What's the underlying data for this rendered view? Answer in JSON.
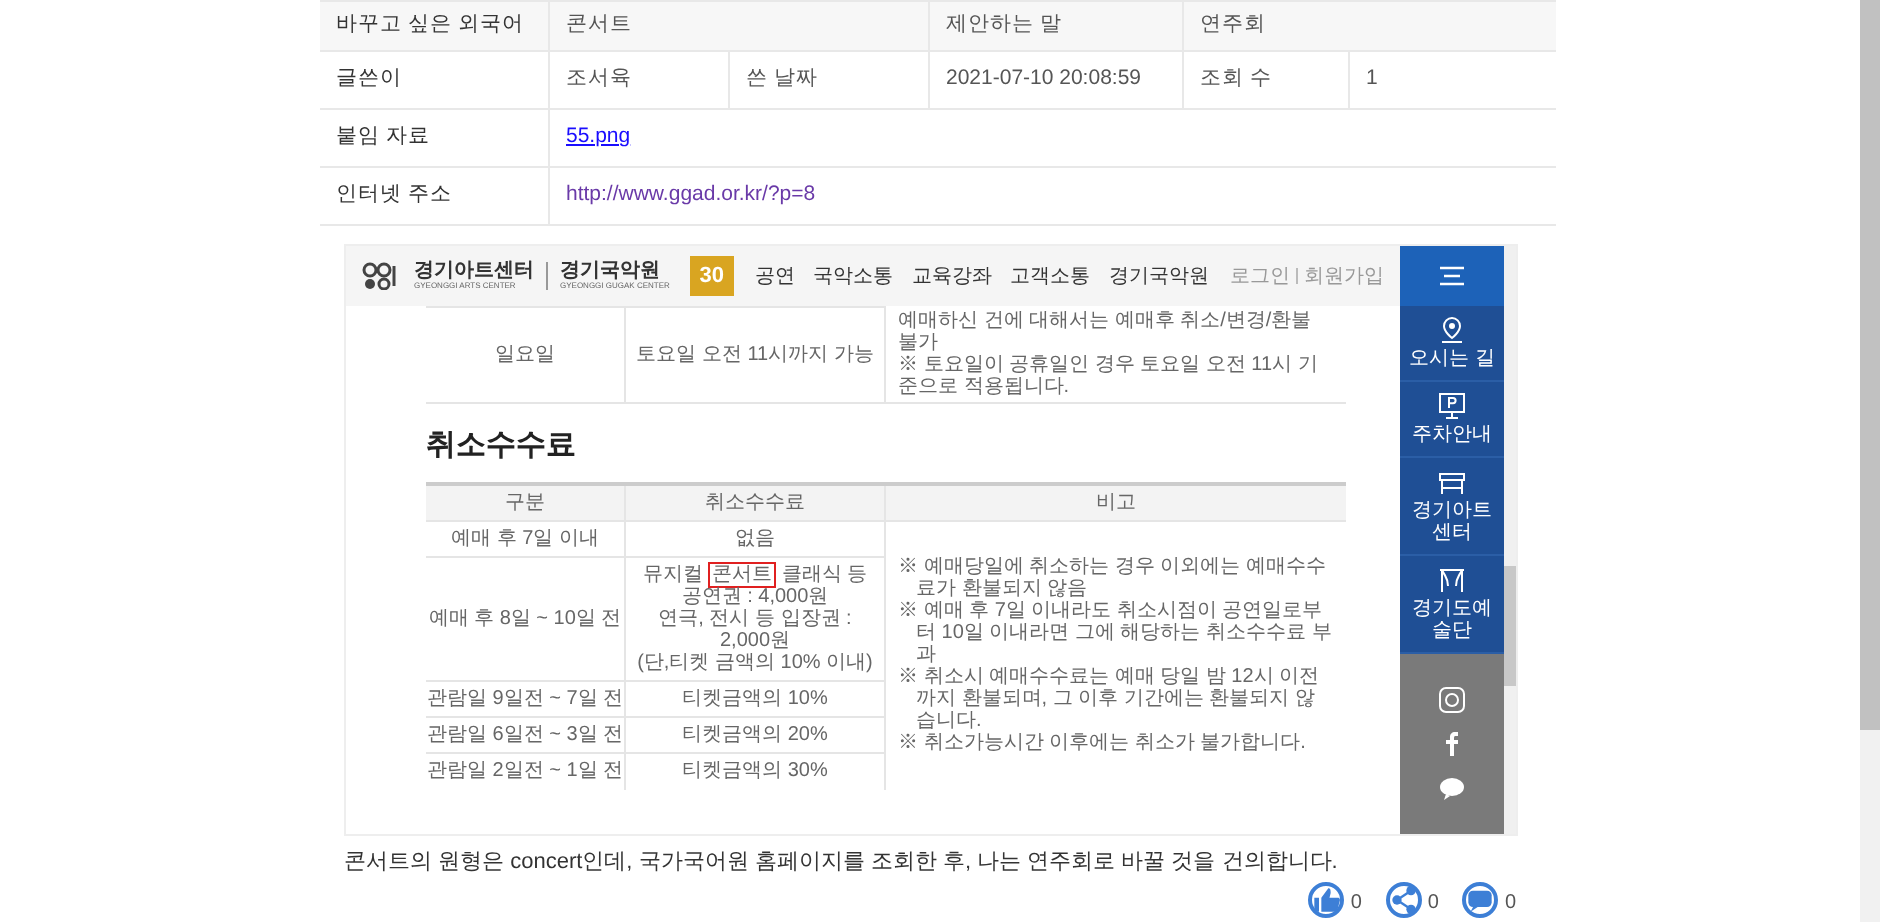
{
  "info_table": {
    "rows": [
      {
        "cells": [
          {
            "kind": "label",
            "text": "바꾸고 싶은 외국어"
          },
          {
            "kind": "text",
            "text": "콘서트"
          },
          {
            "kind": "merged",
            "text": ""
          },
          {
            "kind": "text",
            "text": "제안하는 말"
          },
          {
            "kind": "text",
            "text": "연주회"
          },
          {
            "kind": "merged",
            "text": ""
          }
        ]
      },
      {
        "cells": [
          {
            "kind": "label",
            "text": "글쓴이"
          },
          {
            "kind": "text",
            "text": "조서육"
          },
          {
            "kind": "text",
            "text": "쓴 날짜"
          },
          {
            "kind": "text",
            "text": "2021-07-10 20:08:59"
          },
          {
            "kind": "text",
            "text": "조회 수"
          },
          {
            "kind": "text",
            "text": "1"
          }
        ]
      }
    ],
    "link_rows": [
      {
        "label": "붙임 자료",
        "kind": "file",
        "value": "55.png"
      },
      {
        "label": "인터넷 주소",
        "kind": "url",
        "value": "http://www.ggad.or.kr/?p=8"
      }
    ]
  },
  "attachment_screenshot": {
    "site_header": {
      "brand": "경기아트센터",
      "brand_en": "GYEONGGI ARTS CENTER",
      "sub_brand": "경기국악원",
      "sub_brand_en": "GYEONGGI GUGAK CENTER",
      "badge": "30",
      "nav": [
        "공연",
        "국악소통",
        "교육강좌",
        "고객소통",
        "경기국악원"
      ],
      "account_links": [
        "로그인",
        "회원가입"
      ]
    },
    "partial_row": {
      "day": "일요일",
      "deadline": "토요일 오전 11시까지 가능",
      "notes": [
        "예매하신 건에 대해서는 예매후 취소/변경/환불 불가",
        "※ 토요일이 공휴일인 경우 토요일 오전 11시 기준으로 적용됩니다."
      ]
    },
    "section_title": "취소수수료",
    "fee_table": {
      "columns": [
        "구분",
        "취소수수료",
        "비고"
      ],
      "rows": [
        {
          "period": "예매 후 7일 이내",
          "fee": [
            [
              {
                "text": "없음",
                "boxed": false
              }
            ]
          ]
        },
        {
          "period": "예매 후 8일 ~ 10일 전",
          "fee": [
            [
              {
                "text": "뮤지컬 ",
                "boxed": false
              },
              {
                "text": "콘서트",
                "boxed": true
              },
              {
                "text": " 클래식 등 공연권 : 4,000원",
                "boxed": false
              }
            ],
            [
              {
                "text": "연극, 전시 등 입장권 : 2,000원",
                "boxed": false
              }
            ],
            [
              {
                "text": "(단,티켓 금액의 10% 이내)",
                "boxed": false
              }
            ]
          ]
        },
        {
          "period": "관람일 9일전 ~ 7일 전",
          "fee": [
            [
              {
                "text": "티켓금액의 10%",
                "boxed": false
              }
            ]
          ]
        },
        {
          "period": "관람일 6일전 ~ 3일 전",
          "fee": [
            [
              {
                "text": "티켓금액의 20%",
                "boxed": false
              }
            ]
          ]
        },
        {
          "period": "관람일 2일전 ~ 1일 전",
          "fee": [
            [
              {
                "text": "티켓금액의 30%",
                "boxed": false
              }
            ]
          ]
        }
      ],
      "notes": [
        "※ 예매당일에 취소하는 경우 이외에는 예매수수료가 환불되지 않음",
        "※ 예매 후 7일 이내라도 취소시점이 공연일로부터 10일 이내라면 그에 해당하는 취소수수료 부과",
        "※ 취소시 예매수수료는 예매 당일 밤 12시 이전까지 환불되며, 그 이후 기간에는 환불되지 않습니다.",
        "※ 취소가능시간 이후에는 취소가 불가합니다."
      ]
    },
    "sidebar": {
      "items": [
        {
          "kind": "pin",
          "label": "오시는 길"
        },
        {
          "kind": "parking",
          "label": "주차안내"
        },
        {
          "kind": "building",
          "label": "경기아트센터"
        },
        {
          "kind": "stage",
          "label": "경기도예술단"
        }
      ],
      "social": [
        {
          "kind": "instagram"
        },
        {
          "kind": "facebook"
        },
        {
          "kind": "talk"
        }
      ]
    }
  },
  "comment": "콘서트의 원형은 concert인데, 국가국어원 홈페이지를 조회한 후, 나는 연주회로 바꿀 것을 건의합니다.",
  "reactions": [
    {
      "kind": "like",
      "count": "0"
    },
    {
      "kind": "share",
      "count": "0"
    },
    {
      "kind": "comment",
      "count": "0"
    }
  ]
}
